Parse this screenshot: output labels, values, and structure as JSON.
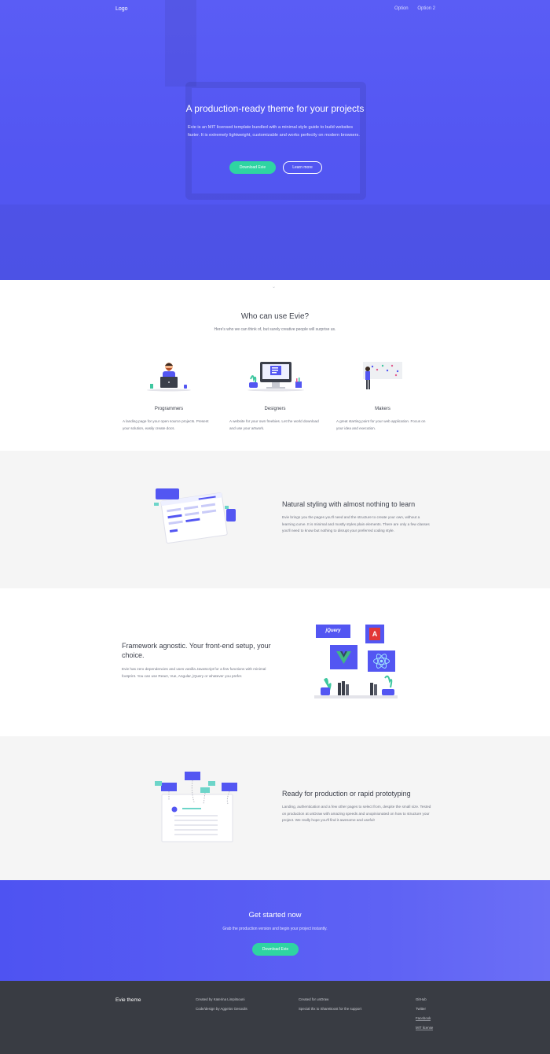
{
  "header": {
    "logo": "Logo",
    "nav": [
      "Option",
      "Option 2"
    ]
  },
  "hero": {
    "title": "A production-ready theme for your projects",
    "text": "Evie is an MIT licensed template bundled with a minimal style guide to build websites faster. It is extremely lightweight, customizable and works perfectly on modern browsers.",
    "primary_button": "Download Evie",
    "secondary_button": "Learn more"
  },
  "who": {
    "title": "Who can use Evie?",
    "subtitle": "Here's who we can think of, but surely creative people will surprise us.",
    "cards": [
      {
        "title": "Programmers",
        "text": "A landing page for your open source projects. Present your solution, easily create docs."
      },
      {
        "title": "Designers",
        "text": "A website for your own freebies. Let the world download and use your artwork."
      },
      {
        "title": "Makers",
        "text": "A great starting point for your web application. Focus on your idea and execution."
      }
    ]
  },
  "feature1": {
    "title": "Natural styling with almost nothing to learn",
    "text": "Evie brings you the pages you'll need and the structure to create your own, without a learning curve. It is minimal and mostly styles plain elements. There are only a few classes you'll need to know but nothing to disrupt your preferred coding style."
  },
  "feature2": {
    "title": "Framework agnostic. Your front-end setup, your choice.",
    "text": "Evie has zero dependencies and uses vanilla JavaScript for a few functions with minimal footprint. You can use React, Vue, Angular, jQuery or whatever you prefer.",
    "logos": {
      "jquery": "jQuery",
      "angular": "A"
    }
  },
  "feature3": {
    "title": "Ready for production or rapid prototyping",
    "text": "Landing, authentication and a few other pages to select from, despite the small size. Tested on production at unDraw with amazing speeds and unopinionated on how to structure your project. We really hope you'll find it awesome and useful!"
  },
  "cta": {
    "title": "Get started now",
    "text": "Grab the production version and begin your project instantly.",
    "button": "Download Evie"
  },
  "footer": {
    "title": "Evie theme",
    "col1": [
      "Created by Katerina Limpitsouni",
      "Code/design by Aggelos Gesoulis"
    ],
    "col2": [
      "Created for unDraw",
      "Special thx to ShareBoost for the support"
    ],
    "links": [
      "GitHub",
      "Twitter",
      "Facebook",
      "MIT license"
    ]
  },
  "colors": {
    "primary": "#5356f2",
    "accent": "#2fd4a2",
    "footer": "#393c43",
    "band": "#f5f5f5"
  }
}
